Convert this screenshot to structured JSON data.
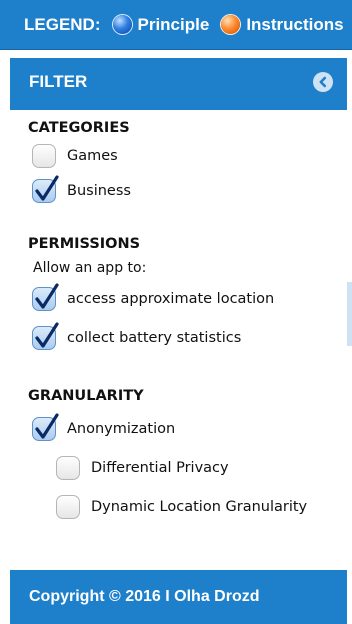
{
  "legend": {
    "title": "LEGEND:",
    "items": [
      {
        "label": "Principle",
        "color": "#2f7fe0",
        "icon": "blue-dot-icon"
      },
      {
        "label": "Instructions",
        "color": "#ff8a2e",
        "icon": "orange-dot-icon"
      }
    ]
  },
  "filter": {
    "title": "FILTER",
    "collapse_icon": "chevron-left-icon",
    "categories": {
      "title": "CATEGORIES",
      "options": [
        {
          "label": "Games",
          "checked": false
        },
        {
          "label": "Business",
          "checked": true
        }
      ]
    },
    "permissions": {
      "title": "PERMISSIONS",
      "subtitle": "Allow an app to:",
      "options": [
        {
          "label": "access approximate location",
          "checked": true
        },
        {
          "label": "collect battery statistics",
          "checked": true
        }
      ]
    },
    "granularity": {
      "title": "GRANULARITY",
      "options": [
        {
          "label": "Anonymization",
          "checked": true
        },
        {
          "label": "Differential Privacy",
          "checked": false
        },
        {
          "label": "Dynamic Location Granularity",
          "checked": false
        }
      ]
    },
    "footer": "Copyright © 2016 I Olha Drozd"
  },
  "colors": {
    "brand_blue": "#1e7fcb",
    "check_mark": "#0a2a66"
  }
}
